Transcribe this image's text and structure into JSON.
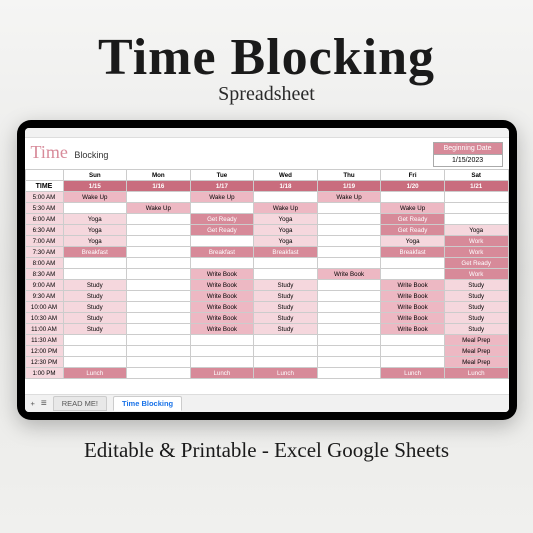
{
  "hero": {
    "title": "Time Blocking",
    "subtitle": "Spreadsheet"
  },
  "caption": "Editable & Printable - Excel Google Sheets",
  "sheet": {
    "logo": {
      "word1": "Time",
      "word2": "Blocking"
    },
    "beginning": {
      "label": "Beginning Date",
      "value": "1/15/2023"
    },
    "time_header": "TIME",
    "days": [
      "Sun",
      "Mon",
      "Tue",
      "Wed",
      "Thu",
      "Fri",
      "Sat"
    ],
    "dates": [
      "1/15",
      "1/16",
      "1/17",
      "1/18",
      "1/19",
      "1/20",
      "1/21"
    ],
    "rows": [
      {
        "t": "5:00 AM",
        "cells": [
          {
            "v": "Wake Up",
            "c": "c-pink"
          },
          {
            "v": "",
            "c": ""
          },
          {
            "v": "Wake Up",
            "c": "c-pink"
          },
          {
            "v": "",
            "c": ""
          },
          {
            "v": "Wake Up",
            "c": "c-pink"
          },
          {
            "v": "",
            "c": ""
          },
          {
            "v": "",
            "c": ""
          }
        ]
      },
      {
        "t": "5:30 AM",
        "cells": [
          {
            "v": "",
            "c": ""
          },
          {
            "v": "Wake Up",
            "c": "c-pink"
          },
          {
            "v": "",
            "c": ""
          },
          {
            "v": "Wake Up",
            "c": "c-pink"
          },
          {
            "v": "",
            "c": ""
          },
          {
            "v": "Wake Up",
            "c": "c-pink"
          },
          {
            "v": "",
            "c": ""
          }
        ]
      },
      {
        "t": "6:00 AM",
        "cells": [
          {
            "v": "Yoga",
            "c": "c-blush"
          },
          {
            "v": "",
            "c": ""
          },
          {
            "v": "Get Ready",
            "c": "c-rose"
          },
          {
            "v": "Yoga",
            "c": "c-blush"
          },
          {
            "v": "",
            "c": ""
          },
          {
            "v": "Get Ready",
            "c": "c-rose"
          },
          {
            "v": "",
            "c": ""
          }
        ]
      },
      {
        "t": "6:30 AM",
        "cells": [
          {
            "v": "Yoga",
            "c": "c-blush"
          },
          {
            "v": "",
            "c": ""
          },
          {
            "v": "Get Ready",
            "c": "c-rose"
          },
          {
            "v": "Yoga",
            "c": "c-blush"
          },
          {
            "v": "",
            "c": ""
          },
          {
            "v": "Get Ready",
            "c": "c-rose"
          },
          {
            "v": "Yoga",
            "c": "c-blush"
          }
        ]
      },
      {
        "t": "7:00 AM",
        "cells": [
          {
            "v": "Yoga",
            "c": "c-blush"
          },
          {
            "v": "",
            "c": ""
          },
          {
            "v": "",
            "c": ""
          },
          {
            "v": "Yoga",
            "c": "c-blush"
          },
          {
            "v": "",
            "c": ""
          },
          {
            "v": "Yoga",
            "c": "c-blush"
          },
          {
            "v": "Work",
            "c": "c-rose"
          }
        ]
      },
      {
        "t": "7:30 AM",
        "cells": [
          {
            "v": "Breakfast",
            "c": "c-rose"
          },
          {
            "v": "",
            "c": ""
          },
          {
            "v": "Breakfast",
            "c": "c-rose"
          },
          {
            "v": "Breakfast",
            "c": "c-rose"
          },
          {
            "v": "",
            "c": ""
          },
          {
            "v": "Breakfast",
            "c": "c-rose"
          },
          {
            "v": "Work",
            "c": "c-rose"
          }
        ]
      },
      {
        "t": "8:00 AM",
        "cells": [
          {
            "v": "",
            "c": ""
          },
          {
            "v": "",
            "c": ""
          },
          {
            "v": "",
            "c": ""
          },
          {
            "v": "",
            "c": ""
          },
          {
            "v": "",
            "c": ""
          },
          {
            "v": "",
            "c": ""
          },
          {
            "v": "Get Ready",
            "c": "c-rose"
          }
        ]
      },
      {
        "t": "8:30 AM",
        "cells": [
          {
            "v": "",
            "c": ""
          },
          {
            "v": "",
            "c": ""
          },
          {
            "v": "Write Book",
            "c": "c-pink"
          },
          {
            "v": "",
            "c": ""
          },
          {
            "v": "Write Book",
            "c": "c-pink"
          },
          {
            "v": "",
            "c": ""
          },
          {
            "v": "Work",
            "c": "c-rose"
          }
        ]
      },
      {
        "t": "9:00 AM",
        "cells": [
          {
            "v": "Study",
            "c": "c-blush"
          },
          {
            "v": "",
            "c": ""
          },
          {
            "v": "Write Book",
            "c": "c-pink"
          },
          {
            "v": "Study",
            "c": "c-blush"
          },
          {
            "v": "",
            "c": ""
          },
          {
            "v": "Write Book",
            "c": "c-pink"
          },
          {
            "v": "Study",
            "c": "c-blush"
          }
        ]
      },
      {
        "t": "9:30 AM",
        "cells": [
          {
            "v": "Study",
            "c": "c-blush"
          },
          {
            "v": "",
            "c": ""
          },
          {
            "v": "Write Book",
            "c": "c-pink"
          },
          {
            "v": "Study",
            "c": "c-blush"
          },
          {
            "v": "",
            "c": ""
          },
          {
            "v": "Write Book",
            "c": "c-pink"
          },
          {
            "v": "Study",
            "c": "c-blush"
          }
        ]
      },
      {
        "t": "10:00 AM",
        "cells": [
          {
            "v": "Study",
            "c": "c-blush"
          },
          {
            "v": "",
            "c": ""
          },
          {
            "v": "Write Book",
            "c": "c-pink"
          },
          {
            "v": "Study",
            "c": "c-blush"
          },
          {
            "v": "",
            "c": ""
          },
          {
            "v": "Write Book",
            "c": "c-pink"
          },
          {
            "v": "Study",
            "c": "c-blush"
          }
        ]
      },
      {
        "t": "10:30 AM",
        "cells": [
          {
            "v": "Study",
            "c": "c-blush"
          },
          {
            "v": "",
            "c": ""
          },
          {
            "v": "Write Book",
            "c": "c-pink"
          },
          {
            "v": "Study",
            "c": "c-blush"
          },
          {
            "v": "",
            "c": ""
          },
          {
            "v": "Write Book",
            "c": "c-pink"
          },
          {
            "v": "Study",
            "c": "c-blush"
          }
        ]
      },
      {
        "t": "11:00 AM",
        "cells": [
          {
            "v": "Study",
            "c": "c-blush"
          },
          {
            "v": "",
            "c": ""
          },
          {
            "v": "Write Book",
            "c": "c-pink"
          },
          {
            "v": "Study",
            "c": "c-blush"
          },
          {
            "v": "",
            "c": ""
          },
          {
            "v": "Write Book",
            "c": "c-pink"
          },
          {
            "v": "Study",
            "c": "c-blush"
          }
        ]
      },
      {
        "t": "11:30 AM",
        "cells": [
          {
            "v": "",
            "c": ""
          },
          {
            "v": "",
            "c": ""
          },
          {
            "v": "",
            "c": ""
          },
          {
            "v": "",
            "c": ""
          },
          {
            "v": "",
            "c": ""
          },
          {
            "v": "",
            "c": ""
          },
          {
            "v": "Meal Prep",
            "c": "c-pink"
          }
        ]
      },
      {
        "t": "12:00 PM",
        "cells": [
          {
            "v": "",
            "c": ""
          },
          {
            "v": "",
            "c": ""
          },
          {
            "v": "",
            "c": ""
          },
          {
            "v": "",
            "c": ""
          },
          {
            "v": "",
            "c": ""
          },
          {
            "v": "",
            "c": ""
          },
          {
            "v": "Meal Prep",
            "c": "c-pink"
          }
        ]
      },
      {
        "t": "12:30 PM",
        "cells": [
          {
            "v": "",
            "c": ""
          },
          {
            "v": "",
            "c": ""
          },
          {
            "v": "",
            "c": ""
          },
          {
            "v": "",
            "c": ""
          },
          {
            "v": "",
            "c": ""
          },
          {
            "v": "",
            "c": ""
          },
          {
            "v": "Meal Prep",
            "c": "c-pink"
          }
        ]
      },
      {
        "t": "1:00 PM",
        "cells": [
          {
            "v": "Lunch",
            "c": "c-rose"
          },
          {
            "v": "",
            "c": ""
          },
          {
            "v": "Lunch",
            "c": "c-rose"
          },
          {
            "v": "Lunch",
            "c": "c-rose"
          },
          {
            "v": "",
            "c": ""
          },
          {
            "v": "Lunch",
            "c": "c-rose"
          },
          {
            "v": "Lunch",
            "c": "c-rose"
          }
        ]
      }
    ],
    "tabs": {
      "menu_icon": "≡",
      "plus": "+",
      "items": [
        {
          "label": "READ ME!",
          "active": false
        },
        {
          "label": "Time Blocking",
          "active": true
        }
      ]
    }
  }
}
